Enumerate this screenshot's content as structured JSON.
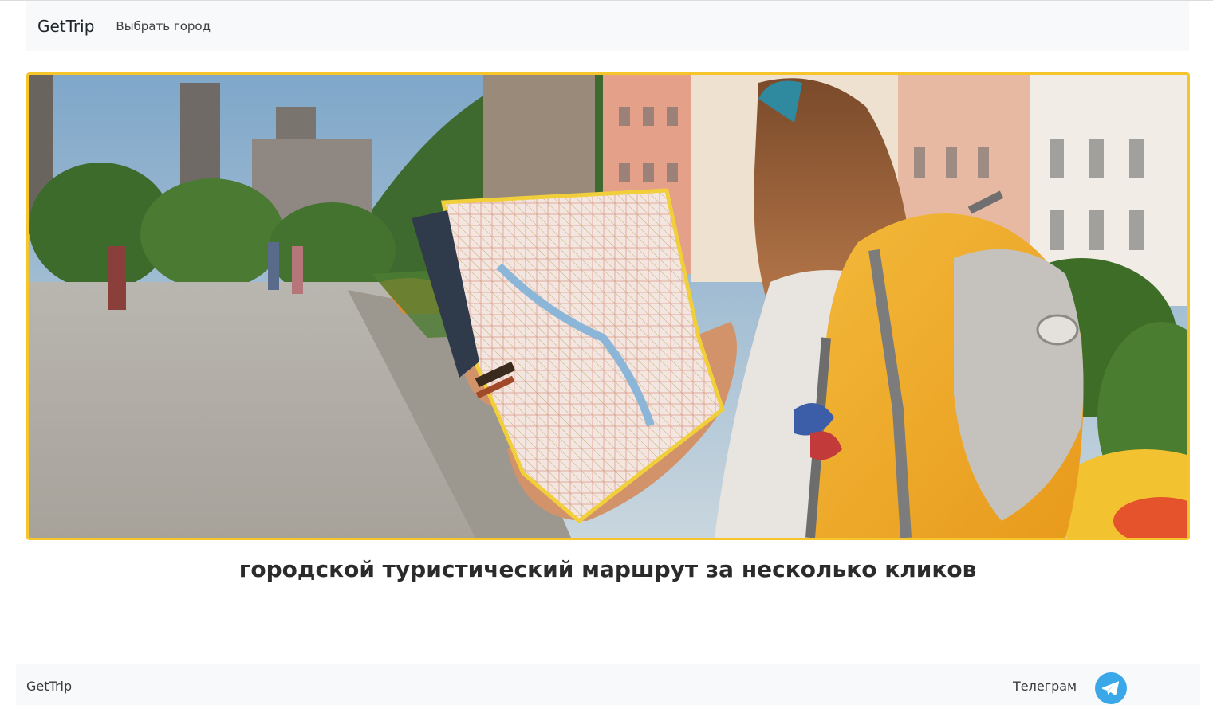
{
  "navbar": {
    "brand": "GetTrip",
    "choose_city": "Выбрать город"
  },
  "hero": {
    "image": "tourist-with-map-photo",
    "border_color": "#f6c42b"
  },
  "tagline": "городской туристический маршрут за несколько кликов",
  "footer": {
    "brand": "GetTrip",
    "telegram_label": "Телеграм",
    "telegram_icon": "telegram-icon",
    "telegram_color": "#3aa8e8"
  }
}
